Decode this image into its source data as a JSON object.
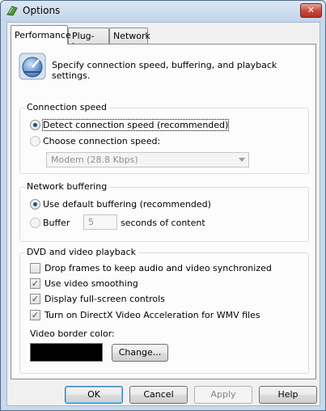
{
  "window": {
    "title": "Options",
    "close_glyph": "✕",
    "accent_close": "#c7463a"
  },
  "tabs": [
    {
      "label": "Performance",
      "active": true
    },
    {
      "label": "Plug-ins",
      "active": false
    },
    {
      "label": "Network",
      "active": false
    }
  ],
  "intro": {
    "icon": "speedometer-icon",
    "text": "Specify connection speed, buffering, and playback settings."
  },
  "connection": {
    "group_label": "Connection speed",
    "detect_label": "Detect connection speed (recommended)",
    "detect_checked": true,
    "choose_label": "Choose connection speed:",
    "choose_checked": false,
    "speed_selected": "Modem (28.8 Kbps)"
  },
  "buffering": {
    "group_label": "Network buffering",
    "default_label": "Use default buffering (recommended)",
    "default_checked": true,
    "buffer_label": "Buffer",
    "buffer_value": "5",
    "seconds_label": "seconds of content"
  },
  "dvd": {
    "group_label": "DVD and video playback",
    "options": [
      {
        "label": "Drop frames to keep audio and video synchronized",
        "checked": false
      },
      {
        "label": "Use video smoothing",
        "checked": true
      },
      {
        "label": "Display full-screen controls",
        "checked": true
      },
      {
        "label": "Turn on DirectX Video Acceleration for WMV files",
        "checked": true
      }
    ],
    "border_color_label": "Video border color:",
    "border_color": "#000000",
    "change_button": "Change..."
  },
  "buttons": {
    "ok": "OK",
    "cancel": "Cancel",
    "apply": "Apply",
    "help": "Help"
  }
}
